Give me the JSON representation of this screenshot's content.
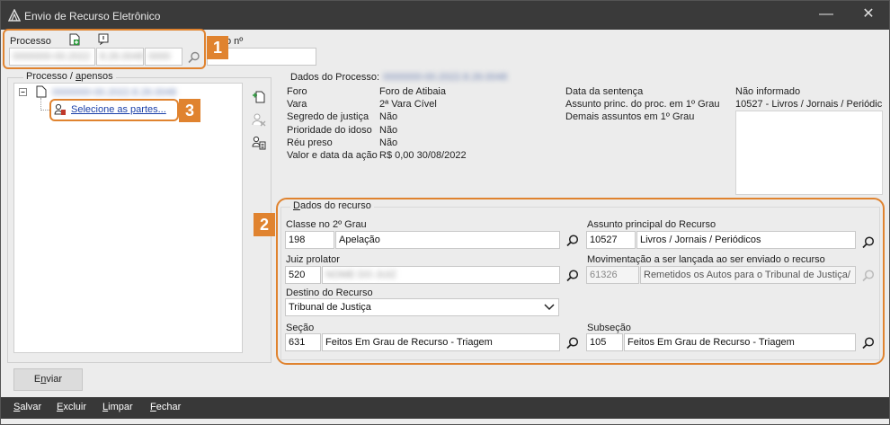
{
  "window": {
    "title": "Envio de Recurso Eletrônico",
    "minimize_glyph": "—",
    "close_glyph": "✕"
  },
  "processo": {
    "label": "Processo",
    "numero_label_suffix": "o nº",
    "value_part1": "0000000-00.2022",
    "value_part2": "8.26.0048",
    "value_part3": "0000",
    "icon1": "new-document-icon",
    "icon2": "info-icon"
  },
  "badges": {
    "b1": "1",
    "b2": "2",
    "b3": "3"
  },
  "tree": {
    "group_label": "Processo / apensos",
    "root_value": "0000000-00.2022.8.26.0048",
    "child_label": "Selecione as partes..."
  },
  "dados_processo": {
    "header": "Dados do Processo:",
    "header_value": "0000000-00.2022.8.26.0048",
    "rows": [
      {
        "label": "Foro",
        "value": "Foro de Atibaia"
      },
      {
        "label": "Vara",
        "value": "2ª Vara Cível"
      },
      {
        "label": "Segredo de justiça",
        "value": "Não"
      },
      {
        "label": "Prioridade do idoso",
        "value": "Não"
      },
      {
        "label": "Réu preso",
        "value": "Não"
      },
      {
        "label": "Valor e data da ação",
        "value": "R$ 0,00 30/08/2022"
      }
    ],
    "right_rows": [
      {
        "label": "Data da sentença",
        "value": "Não informado"
      },
      {
        "label": "Assunto princ. do proc. em 1º Grau",
        "value": "10527 - Livros / Jornais / Periódic"
      },
      {
        "label": "Demais assuntos em 1º Grau",
        "value": ""
      }
    ]
  },
  "dados_recurso": {
    "header": "Dados do recurso",
    "classe": {
      "label": "Classe no 2º Grau",
      "code": "198",
      "text": "Apelação"
    },
    "assunto": {
      "label": "Assunto principal do Recurso",
      "code": "10527",
      "text": "Livros / Jornais / Periódicos"
    },
    "juiz": {
      "label": "Juiz prolator",
      "code": "520",
      "text": "NOME DO JUIZ"
    },
    "movimentacao": {
      "label": "Movimentação a ser lançada ao ser enviado o recurso",
      "code": "61326",
      "text": "Remetidos os Autos para o Tribunal de Justiça/"
    },
    "destino": {
      "label": "Destino do Recurso",
      "value": "Tribunal de Justiça"
    },
    "secao": {
      "label": "Seção",
      "code": "631",
      "text": "Feitos Em Grau de Recurso - Triagem"
    },
    "subsecao": {
      "label": "Subseção",
      "code": "105",
      "text": "Feitos Em Grau de Recurso - Triagem"
    }
  },
  "buttons": {
    "enviar": "Enviar"
  },
  "bottom_menu": [
    "Salvar",
    "Excluir",
    "Limpar",
    "Fechar"
  ],
  "colors": {
    "accent": "#e0832f",
    "titlebar": "#3a3a3a",
    "bottombar": "#383838"
  }
}
